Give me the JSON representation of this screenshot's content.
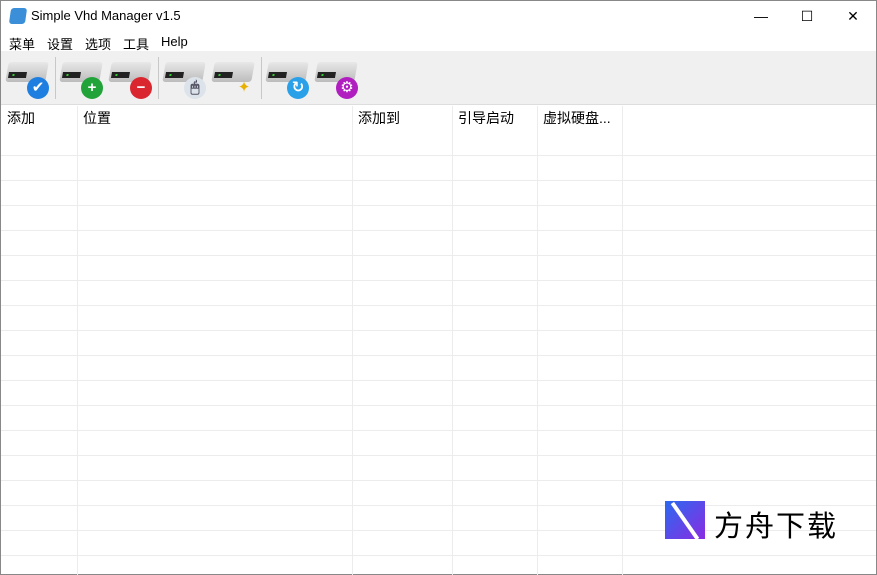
{
  "window": {
    "title": "Simple Vhd Manager v1.5",
    "minimize": "—",
    "maximize": "☐",
    "close": "✕"
  },
  "menu": [
    "菜单",
    "设置",
    "选项",
    "工具",
    "Help"
  ],
  "toolbar": [
    {
      "name": "attach",
      "badge": "✔",
      "color": "#1e7fe0"
    },
    {
      "name": "add",
      "badge": "+",
      "color": "#22a33a"
    },
    {
      "name": "remove",
      "badge": "−",
      "color": "#d9262f"
    },
    {
      "name": "mouse",
      "badge": "🖱",
      "color": "#cfd6e0"
    },
    {
      "name": "wizard",
      "badge": "✦",
      "color": "#e8b000"
    },
    {
      "name": "refresh",
      "badge": "↻",
      "color": "#2aa0e8"
    },
    {
      "name": "tools",
      "badge": "⚙",
      "color": "#b01ec0"
    }
  ],
  "columns": [
    "添加",
    "位置",
    "添加到",
    "引导启动",
    "虚拟硬盘..."
  ],
  "watermark": "方舟下载"
}
